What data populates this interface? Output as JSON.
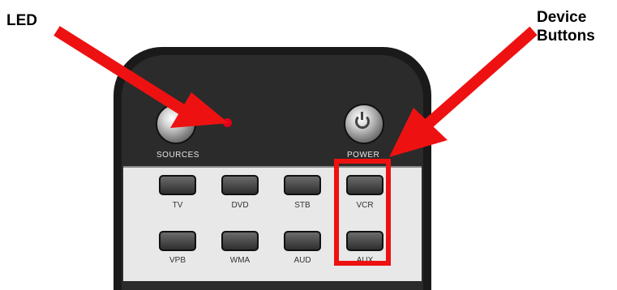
{
  "callouts": {
    "led": "LED",
    "device_line1": "Device",
    "device_line2": "Buttons"
  },
  "remote": {
    "sources_label": "SOURCES",
    "power_label": "POWER",
    "device_buttons": [
      "TV",
      "DVD",
      "STB",
      "VCR",
      "VPB",
      "WMA",
      "AUD",
      "AUX"
    ]
  },
  "colors": {
    "arrow": "#ee1111",
    "led": "#e0001a",
    "remote_body": "#1a1a1a",
    "button_panel": "#e8e8e8"
  }
}
